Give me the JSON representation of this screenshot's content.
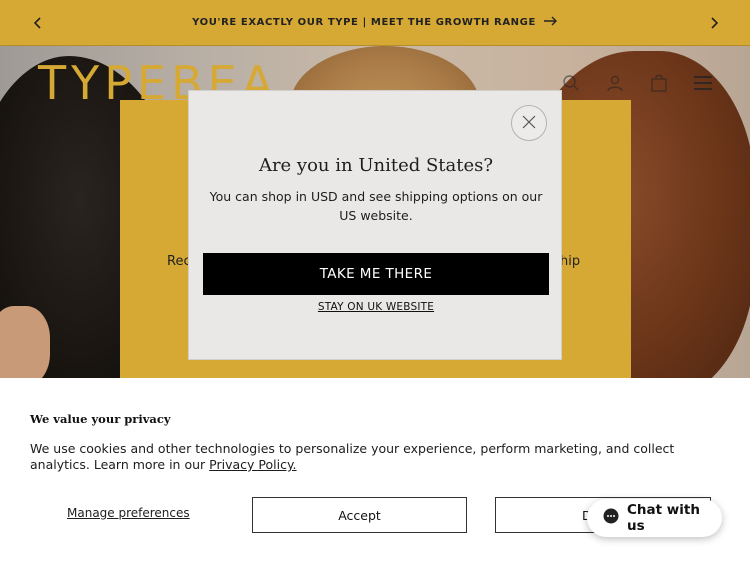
{
  "announcement": {
    "text": "YOU'RE EXACTLY OUR TYPE | MEET THE GROWTH RANGE",
    "bg_color": "#d6a935"
  },
  "header": {
    "logo": "TYPEBEA"
  },
  "region_panel": {
    "partial_left": "Rec",
    "partial_right": "hip",
    "bg_color": "#d6a935"
  },
  "country_dialog": {
    "title": "Are you in United States?",
    "description": "You can shop in USD and see shipping options on our US website.",
    "primary_label": "TAKE ME THERE",
    "secondary_label": "STAY ON UK WEBSITE"
  },
  "cookie_banner": {
    "title": "We value your privacy",
    "text": "We use cookies and other technologies to personalize your experience, perform marketing, and collect analytics. Learn more in our",
    "link_label": "Privacy Policy.",
    "manage_label": "Manage preferences",
    "accept_label": "Accept",
    "decline_label": "D"
  },
  "chat_widget": {
    "label": "Chat with us"
  },
  "icons": [
    "chevron-left-icon",
    "arrow-right-icon",
    "chevron-right-icon",
    "search-icon",
    "bag-icon",
    "menu-icon",
    "close-icon",
    "chat-bubble-icon"
  ]
}
